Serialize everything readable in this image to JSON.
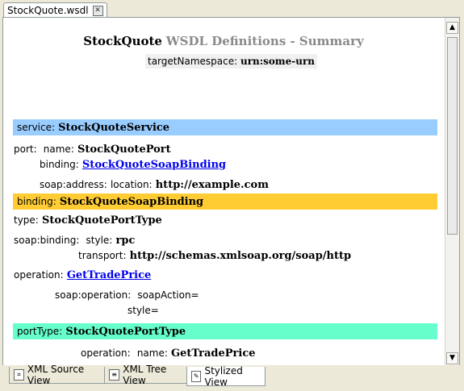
{
  "tab": {
    "title": "StockQuote.wsdl",
    "close_icon": "close-icon"
  },
  "summary": {
    "title_name": "StockQuote",
    "title_rest": "WSDL Definitions - Summary",
    "tns_label": "targetNamespace:",
    "tns_value": "urn:some-urn"
  },
  "service": {
    "header_label": "service:",
    "header_value": "StockQuoteService",
    "port_label": "port:",
    "name_label": "name:",
    "name_value": "StockQuotePort",
    "binding_label": "binding:",
    "binding_link": "StockQuoteSoapBinding",
    "address_label": "soap:address:",
    "location_label": "location:",
    "location_value": "http://example.com"
  },
  "binding": {
    "header_label": "binding:",
    "header_value": "StockQuoteSoapBinding",
    "type_label": "type:",
    "type_value": "StockQuotePortType",
    "soapbinding_label": "soap:binding:",
    "style_label": "style:",
    "style_value": "rpc",
    "transport_label": "transport:",
    "transport_value": "http://schemas.xmlsoap.org/soap/http",
    "operation_label": "operation:",
    "operation_link": "GetTradePrice",
    "soapop_label": "soap:operation:",
    "soapaction_label": "soapAction=",
    "opstyle_label": "style="
  },
  "porttype": {
    "header_label": "portType:",
    "header_value": "StockQuotePortType",
    "operation_label": "operation:",
    "name_label": "name:",
    "name_value": "GetTradePrice"
  },
  "bottom_tabs": [
    {
      "label": "XML Source View"
    },
    {
      "label": "XML Tree View"
    },
    {
      "label": "Stylized View"
    }
  ],
  "colors": {
    "service_band": "#99ccff",
    "binding_band": "#ffcc33",
    "porttype_band": "#66ffcc"
  }
}
